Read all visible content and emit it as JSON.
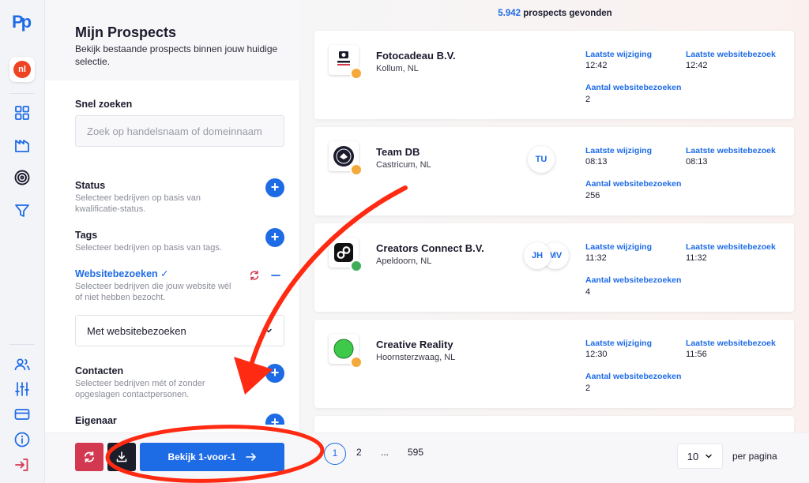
{
  "rail": {
    "logo": "Pp",
    "avatar": "nl"
  },
  "panel": {
    "title": "Mijn Prospects",
    "subtitle": "Bekijk bestaande prospects binnen jouw huidige selectie.",
    "quick_search": {
      "label": "Snel zoeken",
      "placeholder": "Zoek op handelsnaam of domeinnaam"
    },
    "filters": {
      "status": {
        "label": "Status",
        "desc": "Selecteer bedrijven op basis van kwalificatie-status."
      },
      "tags": {
        "label": "Tags",
        "desc": "Selecteer bedrijven op basis van tags."
      },
      "websitebezoeken": {
        "label": "Websitebezoeken",
        "desc": "Selecteer bedrijven die jouw website wél of niet hebben bezocht.",
        "selected": "Met websitebezoeken"
      },
      "contacten": {
        "label": "Contacten",
        "desc": "Selecteer bedrijven mét of zonder opgeslagen contactpersonen."
      },
      "eigenaar": {
        "label": "Eigenaar"
      }
    },
    "footer": {
      "primary_label": "Bekijk 1-voor-1"
    }
  },
  "main": {
    "count_number": "5.942",
    "count_text": " prospects gevonden",
    "field_labels": {
      "last_change": "Laatste wijziging",
      "last_visit": "Laatste websitebezoek",
      "visits": "Aantal websitebezoeken"
    },
    "cards": [
      {
        "name": "Fotocadeau B.V.",
        "location": "Kollum, NL",
        "last_change": "12:42",
        "last_visit": "12:42",
        "visits": "2",
        "users": []
      },
      {
        "name": "Team DB",
        "location": "Castricum, NL",
        "last_change": "08:13",
        "last_visit": "08:13",
        "visits": "256",
        "users": [
          "TU"
        ]
      },
      {
        "name": "Creators Connect B.V.",
        "location": "Apeldoorn, NL",
        "last_change": "11:32",
        "last_visit": "11:32",
        "visits": "4",
        "users": [
          "JH",
          "MV"
        ]
      },
      {
        "name": "Creative Reality",
        "location": "Hoornsterzwaag, NL",
        "last_change": "12:30",
        "last_visit": "11:56",
        "visits": "2",
        "users": []
      }
    ],
    "pagination": {
      "pages": [
        "1",
        "2",
        "...",
        "595"
      ],
      "per_page": "10",
      "per_page_label": "per pagina"
    }
  },
  "colors": {
    "accent": "#1e6be6",
    "reset": "#d23850",
    "annotation": "#ff2a12"
  }
}
